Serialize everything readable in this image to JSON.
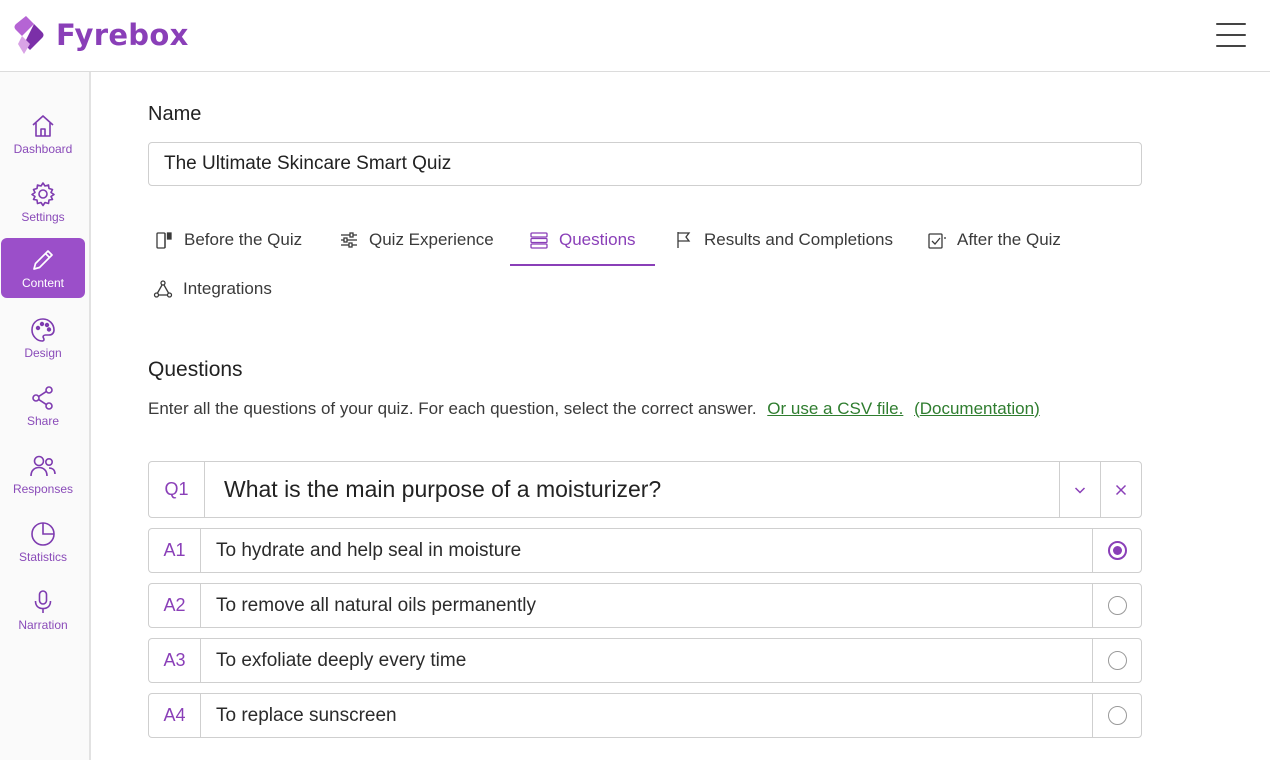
{
  "app": {
    "brand": "Fyrebox",
    "accent_color": "#8a3fb8",
    "link_color": "#2f7d2f"
  },
  "header": {
    "menu_icon": "hamburger-menu-icon"
  },
  "sidebar": {
    "items": [
      {
        "label": "Dashboard",
        "icon": "home-icon",
        "active": false
      },
      {
        "label": "Settings",
        "icon": "gear-icon",
        "active": false
      },
      {
        "label": "Content",
        "icon": "pencil-icon",
        "active": true
      },
      {
        "label": "Design",
        "icon": "palette-icon",
        "active": false
      },
      {
        "label": "Share",
        "icon": "share-icon",
        "active": false
      },
      {
        "label": "Responses",
        "icon": "users-icon",
        "active": false
      },
      {
        "label": "Statistics",
        "icon": "pie-chart-icon",
        "active": false
      },
      {
        "label": "Narration",
        "icon": "microphone-icon",
        "active": false
      }
    ]
  },
  "main": {
    "name_label": "Name",
    "name_value": "The Ultimate Skincare Smart Quiz",
    "tabs": [
      {
        "label": "Before the Quiz",
        "icon": "door-icon",
        "active": false
      },
      {
        "label": "Quiz Experience",
        "icon": "sliders-icon",
        "active": false
      },
      {
        "label": "Questions",
        "icon": "stack-icon",
        "active": true
      },
      {
        "label": "Results and Completions",
        "icon": "flag-icon",
        "active": false
      },
      {
        "label": "After the Quiz",
        "icon": "checkbox-icon",
        "active": false
      },
      {
        "label": "Integrations",
        "icon": "network-icon",
        "active": false
      }
    ],
    "section_title": "Questions",
    "section_desc": "Enter all the questions of your quiz. For each question, select the correct answer.",
    "csv_link": "Or use a CSV file.",
    "doc_link_open": "(",
    "doc_link": "Documentation",
    "doc_link_close": ")",
    "question": {
      "number": "Q1",
      "text": "What is the main purpose of a moisturizer?",
      "collapse_icon": "chevron-down-icon",
      "delete_icon": "close-icon"
    },
    "answers": [
      {
        "number": "A1",
        "text": "To hydrate and help seal in moisture",
        "correct": true
      },
      {
        "number": "A2",
        "text": "To remove all natural oils permanently",
        "correct": false
      },
      {
        "number": "A3",
        "text": "To exfoliate deeply every time",
        "correct": false
      },
      {
        "number": "A4",
        "text": "To replace sunscreen",
        "correct": false
      }
    ]
  }
}
